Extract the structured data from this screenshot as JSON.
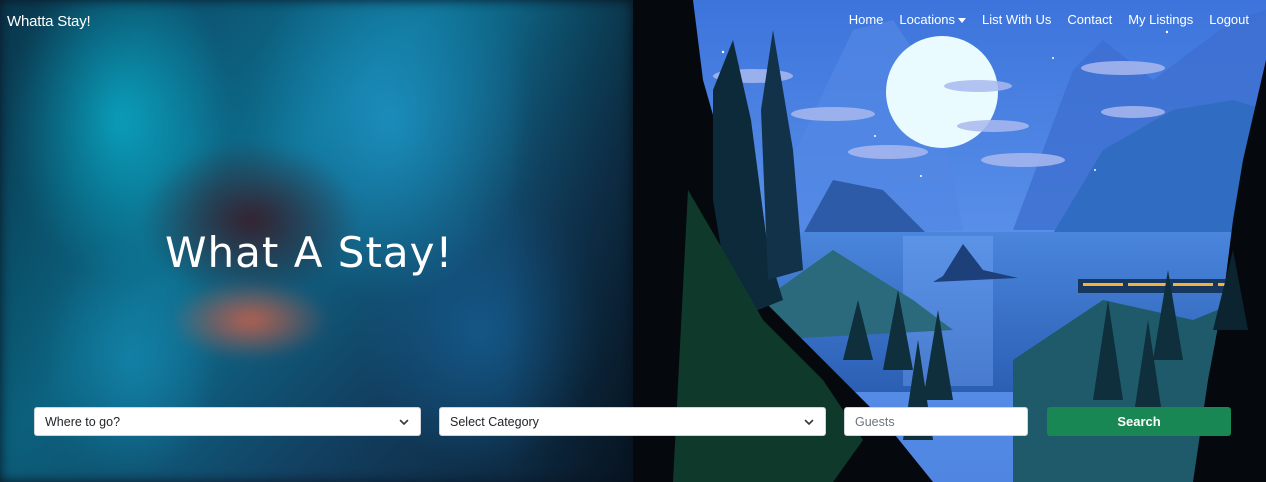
{
  "brand": "Whatta Stay!",
  "nav": {
    "home": "Home",
    "locations": "Locations",
    "list_with_us": "List With Us",
    "contact": "Contact",
    "my_listings": "My Listings",
    "logout": "Logout"
  },
  "hero": {
    "title": "What A Stay!"
  },
  "search": {
    "location": {
      "selected": "Where to go?"
    },
    "category": {
      "selected": "Select Category"
    },
    "guests": {
      "placeholder": "Guests"
    },
    "button": "Search"
  },
  "colors": {
    "search_button": "#198754",
    "night_sky": "#4a7fe0"
  },
  "icons": [
    "chevron-down-icon",
    "caret-down-icon"
  ]
}
